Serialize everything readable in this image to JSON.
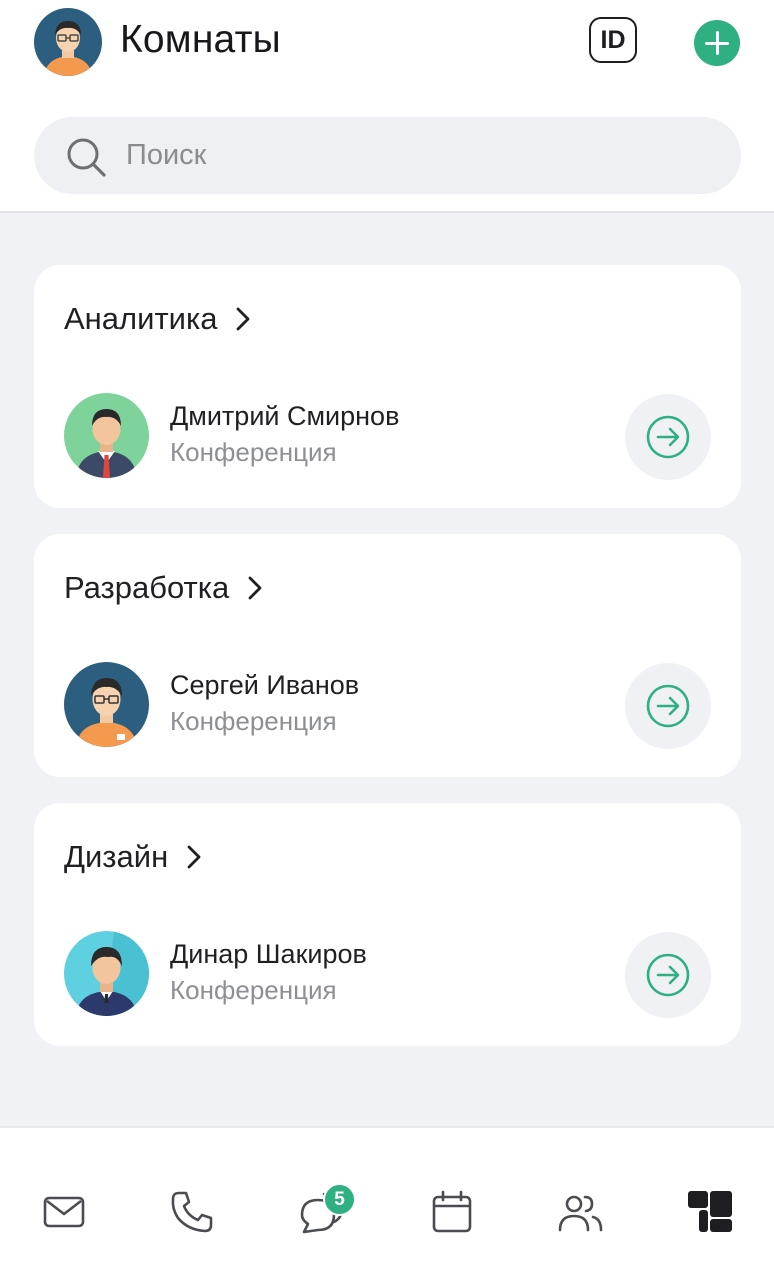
{
  "header": {
    "title": "Комнаты",
    "id_button_label": "ID",
    "add_button_icon": "plus-icon",
    "accent_color": "#2fb083"
  },
  "search": {
    "placeholder": "Поиск",
    "value": ""
  },
  "rooms": [
    {
      "title": "Аналитика",
      "contact_name": "Дмитрий Смирнов",
      "contact_status": "Конференция"
    },
    {
      "title": "Разработка",
      "contact_name": "Сергей Иванов",
      "contact_status": "Конференция"
    },
    {
      "title": "Дизайн",
      "contact_name": "Динар Шакиров",
      "contact_status": "Конференция"
    }
  ],
  "tabbar": {
    "tabs": [
      {
        "icon": "mail-icon"
      },
      {
        "icon": "phone-icon"
      },
      {
        "icon": "chat-icon",
        "badge": "5"
      },
      {
        "icon": "calendar-icon"
      },
      {
        "icon": "contacts-icon"
      },
      {
        "icon": "rooms-icon",
        "active": true
      }
    ]
  }
}
